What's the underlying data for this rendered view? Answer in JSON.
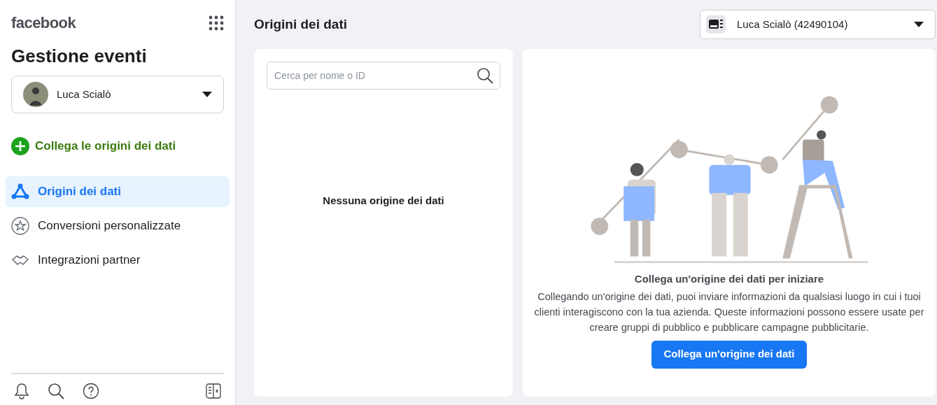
{
  "sidebar": {
    "logo": "facebook",
    "title": "Gestione eventi",
    "account": {
      "name": "Luca Scialò"
    },
    "connect_link": "Collega le origini dei dati",
    "items": [
      {
        "label": "Origini dei dati",
        "selected": true
      },
      {
        "label": "Conversioni personalizzate",
        "selected": false
      },
      {
        "label": "Integrazioni partner",
        "selected": false
      }
    ]
  },
  "header": {
    "title": "Origini dei dati",
    "account_select": "Luca Scialò (42490104)"
  },
  "list_panel": {
    "search": {
      "placeholder": "Cerca per nome o ID"
    },
    "empty_text": "Nessuna origine dei dati"
  },
  "detail_panel": {
    "heading": "Collega un'origine dei dati per iniziare",
    "body": "Collegando un'origine dei dati, puoi inviare informazioni da qualsiasi luogo in cui i tuoi clienti interagiscono con la tua azienda. Queste informazioni possono essere usate per creare gruppi di pubblico e pubblicare campagne pubblicitarie.",
    "button": "Collega un'origine dei dati"
  }
}
